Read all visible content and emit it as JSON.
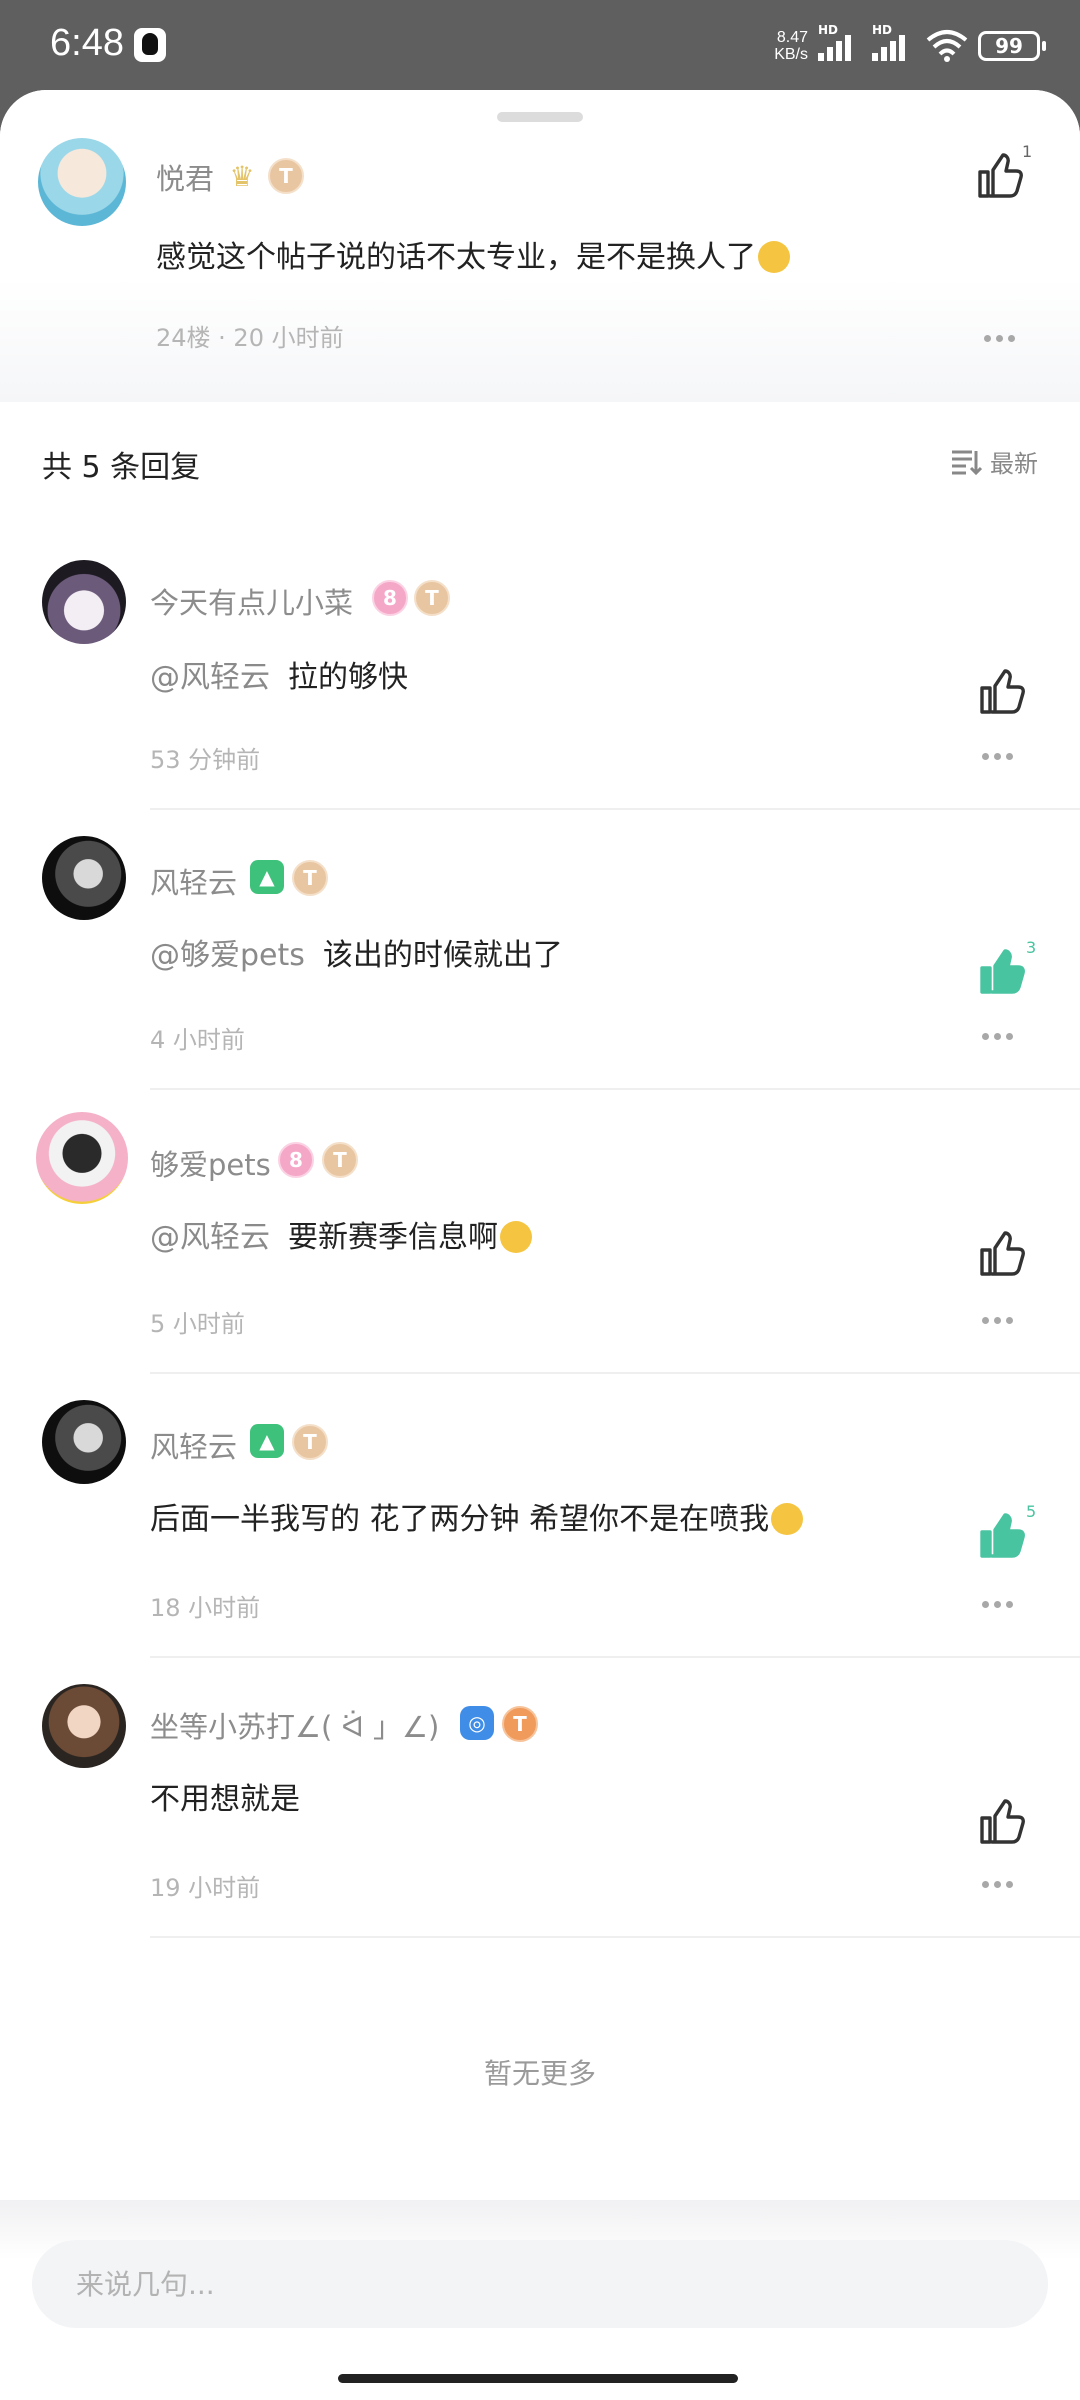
{
  "status_bar": {
    "time": "6:48",
    "net_speed_value": "8.47",
    "net_speed_unit": "KB/s",
    "battery": "99"
  },
  "top_comment": {
    "user": "悦君",
    "level": "T",
    "text": "感觉这个帖子说的话不太专业，是不是换人了",
    "floor_time": "24楼 · 20 小时前",
    "likes": "1"
  },
  "replies_header": {
    "title": "共 5 条回复",
    "sort_label": "最新"
  },
  "replies": [
    {
      "user": "今天有点儿小菜",
      "mention": "@风轻云",
      "text": "拉的够快",
      "time": "53 分钟前",
      "likes": ""
    },
    {
      "user": "风轻云",
      "mention": "@够爱pets",
      "text": "该出的时候就出了",
      "time": "4 小时前",
      "likes": "3"
    },
    {
      "user": "够爱pets",
      "mention": "@风轻云",
      "text": "要新赛季信息啊",
      "time": "5 小时前",
      "likes": ""
    },
    {
      "user": "风轻云",
      "mention": "",
      "text": "后面一半我写的 花了两分钟 希望你不是在喷我",
      "time": "18 小时前",
      "likes": "5"
    },
    {
      "user": "坐等小苏打∠( ᐛ 」∠)",
      "mention": "",
      "text": "不用想就是",
      "time": "19 小时前",
      "likes": ""
    }
  ],
  "footer": {
    "no_more": "暂无更多",
    "input_placeholder": "来说几句..."
  },
  "colors": {
    "accent_like": "#49c4a0",
    "muted_text": "#8c8c8c"
  }
}
